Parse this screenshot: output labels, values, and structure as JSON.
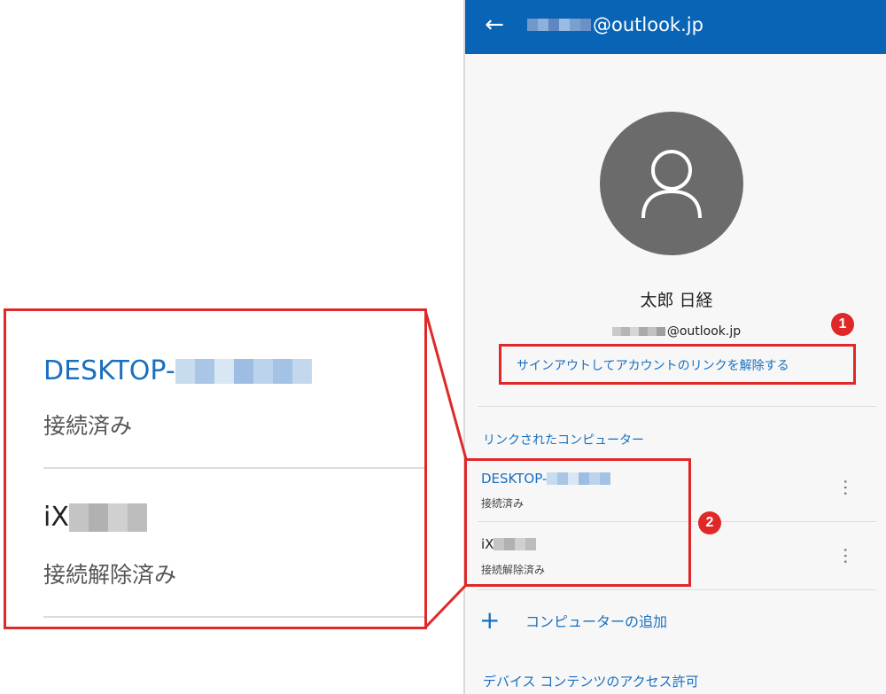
{
  "appbar": {
    "back_icon": "arrow-left-icon",
    "title_suffix": "@outlook.jp",
    "bg_color": "#0a64b6"
  },
  "profile": {
    "avatar_icon": "person-icon",
    "name": "太郎 日経",
    "email_suffix": "@outlook.jp"
  },
  "signout_link": "サインアウトしてアカウントのリンクを解除する",
  "linked": {
    "section_title": "リンクされたコンピューター",
    "computers": [
      {
        "name": "DESKTOP-",
        "status": "接続済み"
      },
      {
        "name": "iX",
        "status": "接続解除済み"
      }
    ],
    "more_icon": "more-vertical-icon"
  },
  "add_computer": {
    "icon": "plus-icon",
    "label": "コンピューターの追加"
  },
  "access_link": "デバイス コンテンツのアクセス許可",
  "annotations": {
    "badge_1": "1",
    "badge_2": "2",
    "color": "#e02828"
  },
  "zoom": {
    "items": [
      {
        "name": "DESKTOP-",
        "status": "接続済み"
      },
      {
        "name": "iX",
        "status": "接続解除済み"
      }
    ]
  }
}
